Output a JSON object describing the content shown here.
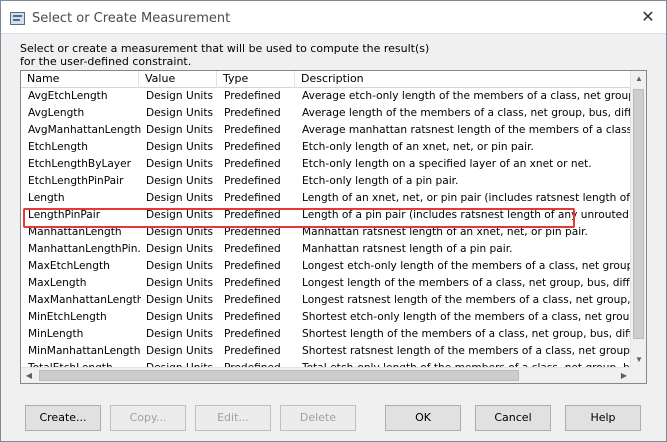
{
  "window": {
    "title": "Select or Create Measurement",
    "close_glyph": "✕",
    "icon": "measurement-app-icon"
  },
  "instruction": "Select or create a measurement that will be used to compute the result(s) for the user-defined constraint.",
  "table": {
    "columns": [
      "Name",
      "Value",
      "Type",
      "Description"
    ],
    "rows": [
      {
        "name": "AvgEtchLength",
        "value": "Design Units",
        "type": "Predefined",
        "description": "Average etch-only length of the members of a class, net group, bus, di"
      },
      {
        "name": "AvgLength",
        "value": "Design Units",
        "type": "Predefined",
        "description": "Average length of the members of a class, net group, bus, differential"
      },
      {
        "name": "AvgManhattanLength",
        "value": "Design Units",
        "type": "Predefined",
        "description": "Average manhattan ratsnest length of the members of a class, net grou"
      },
      {
        "name": "EtchLength",
        "value": "Design Units",
        "type": "Predefined",
        "description": "Etch-only length of an xnet, net, or pin pair."
      },
      {
        "name": "EtchLengthByLayer",
        "value": "Design Units",
        "type": "Predefined",
        "description": "Etch-only length on a specified layer of an xnet or net."
      },
      {
        "name": "EtchLengthPinPair",
        "value": "Design Units",
        "type": "Predefined",
        "description": "Etch-only length of a pin pair."
      },
      {
        "name": "Length",
        "value": "Design Units",
        "type": "Predefined",
        "description": "Length of an xnet, net, or pin pair (includes ratsnest length of any unro"
      },
      {
        "name": "LengthPinPair",
        "value": "Design Units",
        "type": "Predefined",
        "description": "Length of a pin pair (includes ratsnest length of any unrouted connecti"
      },
      {
        "name": "ManhattanLength",
        "value": "Design Units",
        "type": "Predefined",
        "description": "Manhattan ratsnest length of an xnet, net, or pin pair."
      },
      {
        "name": "ManhattanLengthPin...",
        "value": "Design Units",
        "type": "Predefined",
        "description": "Manhattan ratsnest length of a pin pair."
      },
      {
        "name": "MaxEtchLength",
        "value": "Design Units",
        "type": "Predefined",
        "description": "Longest etch-only length of the members of a class, net group, bus, dif"
      },
      {
        "name": "MaxLength",
        "value": "Design Units",
        "type": "Predefined",
        "description": "Longest length of the members of a class, net group, bus, differential p"
      },
      {
        "name": "MaxManhattanLength",
        "value": "Design Units",
        "type": "Predefined",
        "description": "Longest ratsnest length of the members of a class, net group, bus, diff."
      },
      {
        "name": "MinEtchLength",
        "value": "Design Units",
        "type": "Predefined",
        "description": "Shortest etch-only length of the members of a class, net group, bus, di"
      },
      {
        "name": "MinLength",
        "value": "Design Units",
        "type": "Predefined",
        "description": "Shortest length of the members of a class, net group, bus, differential"
      },
      {
        "name": "MinManhattanLength",
        "value": "Design Units",
        "type": "Predefined",
        "description": "Shortest ratsnest length of the members of a class, net group, bus, diff."
      },
      {
        "name": "TotalEtchLength",
        "value": "Design Units",
        "type": "Predefined",
        "description": "Total etch-only length of the members of a class, net group, bus, diffe"
      }
    ],
    "highlighted_row": "EtchLength",
    "highlight_color": "#e53935"
  },
  "scrollbars": {
    "up": "▲",
    "down": "▼",
    "left": "◀",
    "right": "▶"
  },
  "buttons": {
    "create": "Create...",
    "copy": "Copy...",
    "edit": "Edit...",
    "delete": "Delete",
    "ok": "OK",
    "cancel": "Cancel",
    "help": "Help"
  }
}
